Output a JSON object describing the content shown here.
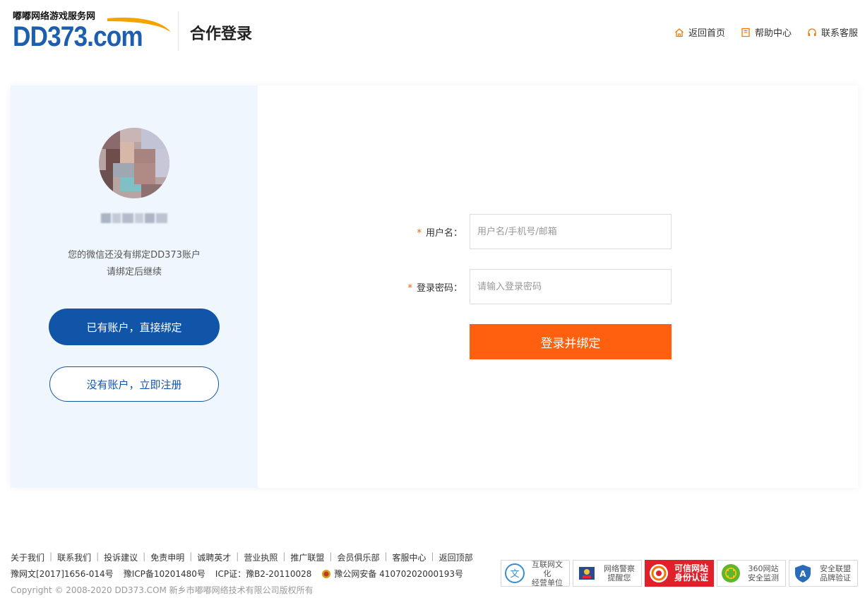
{
  "header": {
    "logo_tagline": "嘟嘟网络游戏服务网",
    "logo_text": "DD373.com",
    "page_title": "合作登录",
    "nav": [
      {
        "label": "返回首页",
        "icon": "home-icon"
      },
      {
        "label": "帮助中心",
        "icon": "help-book-icon"
      },
      {
        "label": "联系客服",
        "icon": "headset-icon"
      }
    ]
  },
  "left_panel": {
    "message_line1": "您的微信还没有绑定DD373账户",
    "message_line2": "请绑定后继续",
    "bind_button": "已有账户，直接绑定",
    "register_button": "没有账户，立即注册"
  },
  "form": {
    "username_label": "用户名：",
    "username_placeholder": "用户名/手机号/邮箱",
    "password_label": "登录密码：",
    "password_placeholder": "请输入登录密码",
    "submit_button": "登录并绑定",
    "required_mark": "*"
  },
  "footer": {
    "links": [
      "关于我们",
      "联系我们",
      "投诉建议",
      "免责申明",
      "诚聘英才",
      "营业执照",
      "推广联盟",
      "会员俱乐部",
      "客服中心",
      "返回顶部"
    ],
    "reg1": "豫网文[2017]1656-014号",
    "reg2": "豫ICP备10201480号",
    "reg3": "ICP证：豫B2-20110028",
    "reg4": "豫公网安备 41070202000193号",
    "copyright": "Copyright © 2008-2020 DD373.COM 新乡市嘟嘟网络技术有限公司版权所有",
    "badges": [
      {
        "line1": "互联网文化",
        "line2": "经营单位",
        "icon": "culture-badge-icon"
      },
      {
        "line1": "网络警察",
        "line2": "提醒您",
        "icon": "police-badge-icon"
      },
      {
        "line1": "可信网站",
        "line2": "身份认证",
        "icon": "trusted-site-icon"
      },
      {
        "line1": "360网站",
        "line2": "安全监测",
        "icon": "360-safe-icon"
      },
      {
        "line1": "安全联盟",
        "line2": "品牌验证",
        "icon": "security-alliance-icon"
      }
    ]
  },
  "colors": {
    "brand_blue": "#1155a8",
    "accent_orange": "#ff6010",
    "panel_bg": "#f0f6fd"
  }
}
